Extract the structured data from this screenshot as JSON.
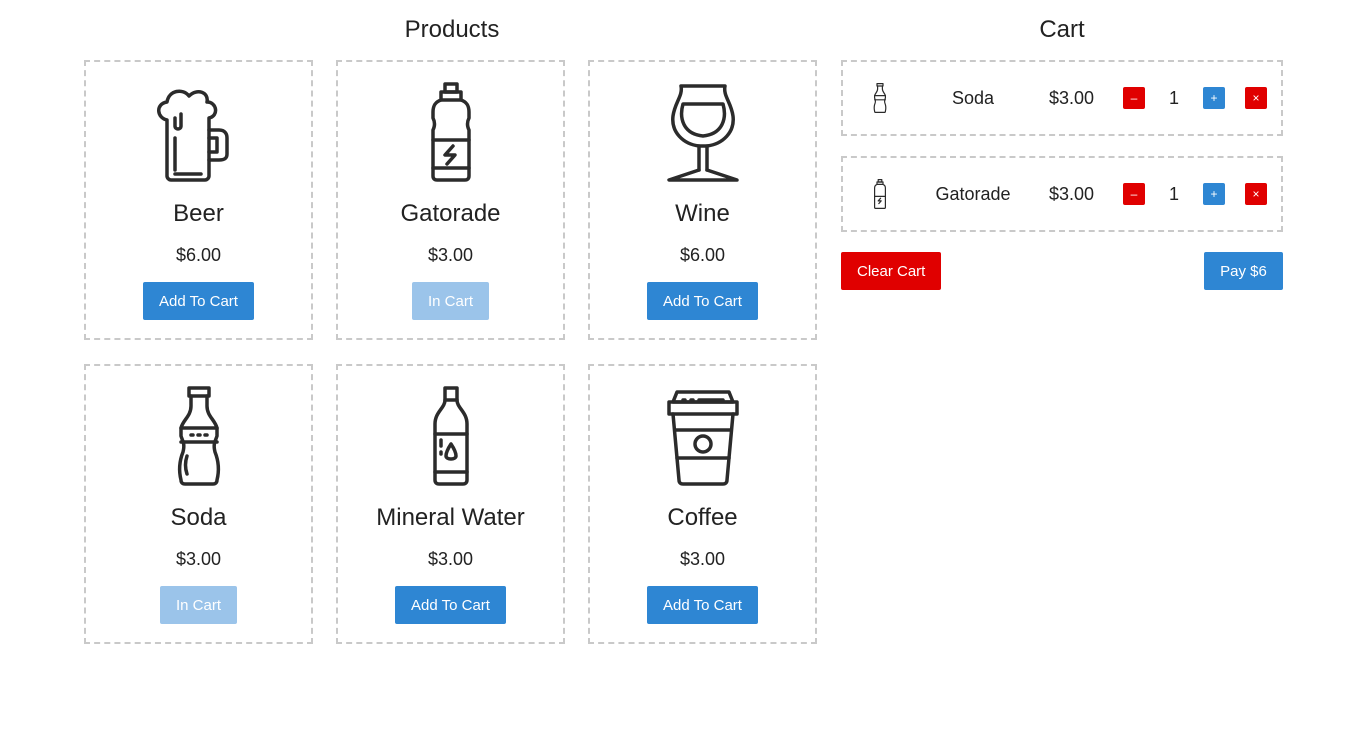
{
  "products_heading": "Products",
  "cart_heading": "Cart",
  "products": [
    {
      "name": "Beer",
      "price": "$6.00",
      "button": "Add To Cart",
      "in_cart": false,
      "icon": "beer-mug-icon"
    },
    {
      "name": "Gatorade",
      "price": "$3.00",
      "button": "In Cart",
      "in_cart": true,
      "icon": "sports-bottle-icon"
    },
    {
      "name": "Wine",
      "price": "$6.00",
      "button": "Add To Cart",
      "in_cart": false,
      "icon": "wine-glass-icon"
    },
    {
      "name": "Soda",
      "price": "$3.00",
      "button": "In Cart",
      "in_cart": true,
      "icon": "soda-bottle-icon"
    },
    {
      "name": "Mineral Water",
      "price": "$3.00",
      "button": "Add To Cart",
      "in_cart": false,
      "icon": "water-bottle-icon"
    },
    {
      "name": "Coffee",
      "price": "$3.00",
      "button": "Add To Cart",
      "in_cart": false,
      "icon": "coffee-cup-icon"
    }
  ],
  "cart": {
    "items": [
      {
        "name": "Soda",
        "price": "$3.00",
        "qty": "1",
        "minus": "–",
        "plus": "+",
        "remove": "×",
        "icon": "soda-bottle-icon"
      },
      {
        "name": "Gatorade",
        "price": "$3.00",
        "qty": "1",
        "minus": "–",
        "plus": "+",
        "remove": "×",
        "icon": "sports-bottle-icon"
      }
    ],
    "clear_label": "Clear Cart",
    "pay_label": "Pay $6"
  },
  "colors": {
    "primary": "#2e86d3",
    "primary_disabled": "#9bc4ea",
    "danger": "#e00000",
    "border": "#c9c9c9"
  }
}
